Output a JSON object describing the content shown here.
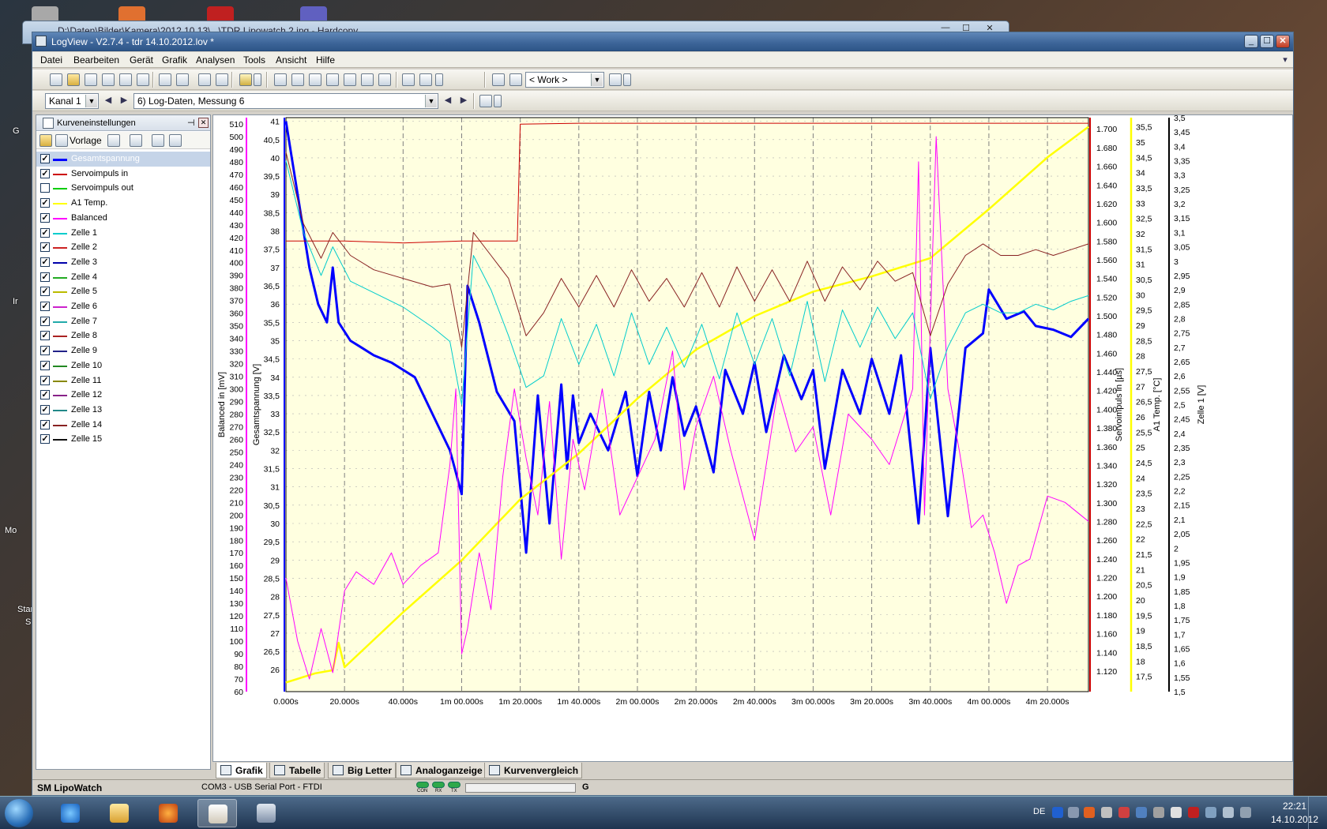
{
  "behind_window": {
    "title": "D:\\Daten\\Bilder\\Kamera\\2012.10.13\\...\\TDR Lipowatch 2.jpg - Hardcopy"
  },
  "desktop": {
    "labels": [
      "G",
      "Ir",
      "Mo",
      "Star",
      "S"
    ]
  },
  "window": {
    "title": "LogView - V2.7.4 - tdr 14.10.2012.lov *"
  },
  "menu": [
    "Datei",
    "Bearbeiten",
    "Gerät",
    "Grafik",
    "Analysen",
    "Tools",
    "Ansicht",
    "Hilfe"
  ],
  "toolbar": {
    "work_combo": "< Work >"
  },
  "toolbar2": {
    "channel": "Kanal 1",
    "measurement": "6) Log-Daten, Messung 6"
  },
  "sidebar": {
    "title": "Kurveneinstellungen",
    "template_label": "Vorlage",
    "curves": [
      {
        "name": "Gesamtspannung",
        "checked": true,
        "color": "#0000ff",
        "selected": true
      },
      {
        "name": "Servoimpuls in",
        "checked": true,
        "color": "#cc0000"
      },
      {
        "name": "Servoimpuls out",
        "checked": false,
        "color": "#00cc00"
      },
      {
        "name": "A1 Temp.",
        "checked": true,
        "color": "#ffff00"
      },
      {
        "name": "Balanced",
        "checked": true,
        "color": "#ff00ff"
      },
      {
        "name": "Zelle 1",
        "checked": true,
        "color": "#00cccc"
      },
      {
        "name": "Zelle 2",
        "checked": true,
        "color": "#cc2222"
      },
      {
        "name": "Zelle 3",
        "checked": true,
        "color": "#0000aa"
      },
      {
        "name": "Zelle 4",
        "checked": true,
        "color": "#22aa22"
      },
      {
        "name": "Zelle 5",
        "checked": true,
        "color": "#bbbb00"
      },
      {
        "name": "Zelle 6",
        "checked": true,
        "color": "#cc22cc"
      },
      {
        "name": "Zelle 7",
        "checked": true,
        "color": "#22aaaa"
      },
      {
        "name": "Zelle 8",
        "checked": true,
        "color": "#aa2222"
      },
      {
        "name": "Zelle 9",
        "checked": true,
        "color": "#222288"
      },
      {
        "name": "Zelle 10",
        "checked": true,
        "color": "#228822"
      },
      {
        "name": "Zelle 11",
        "checked": true,
        "color": "#888800"
      },
      {
        "name": "Zelle 12",
        "checked": true,
        "color": "#882288"
      },
      {
        "name": "Zelle 13",
        "checked": true,
        "color": "#228888"
      },
      {
        "name": "Zelle 14",
        "checked": true,
        "color": "#882222"
      },
      {
        "name": "Zelle 15",
        "checked": true,
        "color": "#111111"
      }
    ]
  },
  "tabs": [
    "Grafik",
    "Tabelle",
    "Big Letter",
    "Analoganzeige",
    "Kurvenvergleich"
  ],
  "status": {
    "device": "SM LipoWatch",
    "port": "COM3 - USB Serial Port - FTDI",
    "leds": [
      "CON",
      "RX",
      "TX"
    ],
    "right": "G"
  },
  "taskbar": {
    "lang": "DE",
    "time": "22:21",
    "date": "14.10.2012"
  },
  "colors": {
    "plot_bg": "#ffffe0",
    "accent": "#3c6498"
  },
  "chart_data": {
    "type": "line",
    "x_ticks": [
      "0.000s",
      "20.000s",
      "40.000s",
      "1m 00.000s",
      "1m 20.000s",
      "1m 40.000s",
      "2m 00.000s",
      "2m 20.000s",
      "2m 40.000s",
      "3m 00.000s",
      "3m 20.000s",
      "3m 40.000s",
      "4m 00.000s",
      "4m 20.000s"
    ],
    "xlim": [
      0,
      274
    ],
    "grid": true,
    "axes": [
      {
        "id": "balanced",
        "title": "Balanced in [mV]",
        "side": "left",
        "ylim": [
          60,
          515
        ],
        "ticks": [
          "510",
          "500",
          "490",
          "480",
          "470",
          "460",
          "450",
          "440",
          "430",
          "420",
          "410",
          "400",
          "390",
          "380",
          "370",
          "360",
          "350",
          "340",
          "330",
          "320",
          "310",
          "300",
          "290",
          "280",
          "270",
          "260",
          "250",
          "240",
          "230",
          "220",
          "210",
          "200",
          "190",
          "180",
          "170",
          "160",
          "150",
          "140",
          "130",
          "120",
          "110",
          "100",
          "90",
          "80",
          "70",
          "60"
        ]
      },
      {
        "id": "gesamt",
        "title": "Gesamtspannung [V]",
        "side": "left",
        "ylim": [
          25.4,
          41.1
        ],
        "ticks": [
          "41",
          "40,5",
          "40",
          "39,5",
          "39",
          "38,5",
          "38",
          "37,5",
          "37",
          "36,5",
          "36",
          "35,5",
          "35",
          "34,5",
          "34",
          "33,5",
          "33",
          "32,5",
          "32",
          "31,5",
          "31",
          "30,5",
          "30",
          "29,5",
          "29",
          "28,5",
          "28",
          "27,5",
          "27",
          "26,5",
          "26"
        ]
      },
      {
        "id": "servo",
        "title": "Servoimpuls in [µs]",
        "side": "right",
        "ylim": [
          1.098,
          1.712
        ],
        "ticks": [
          "1.700",
          "1.680",
          "1.660",
          "1.640",
          "1.620",
          "1.600",
          "1.580",
          "1.560",
          "1.540",
          "1.520",
          "1.500",
          "1.480",
          "1.460",
          "1.440",
          "1.420",
          "1.400",
          "1.380",
          "1.360",
          "1.340",
          "1.320",
          "1.300",
          "1.280",
          "1.260",
          "1.240",
          "1.220",
          "1.200",
          "1.180",
          "1.160",
          "1.140",
          "1.120"
        ]
      },
      {
        "id": "temp",
        "title": "A1 Temp. [°C]",
        "side": "right",
        "ylim": [
          17,
          35.8
        ],
        "ticks": [
          "35,5",
          "35",
          "34,5",
          "34",
          "33,5",
          "33",
          "32,5",
          "32",
          "31,5",
          "31",
          "30,5",
          "30",
          "29,5",
          "29",
          "28,5",
          "28",
          "27,5",
          "27",
          "26,5",
          "26",
          "25,5",
          "25",
          "24,5",
          "24",
          "23,5",
          "23",
          "22,5",
          "22",
          "21,5",
          "21",
          "20,5",
          "20",
          "19,5",
          "19",
          "18,5",
          "18",
          "17,5"
        ]
      },
      {
        "id": "zelle",
        "title": "Zelle 1 [V]",
        "side": "right",
        "ylim": [
          1.5,
          3.5
        ],
        "ticks": [
          "3,5",
          "3,45",
          "3,4",
          "3,35",
          "3,3",
          "3,25",
          "3,2",
          "3,15",
          "3,1",
          "3,05",
          "3",
          "2,95",
          "2,9",
          "2,85",
          "2,8",
          "2,75",
          "2,7",
          "2,65",
          "2,6",
          "2,55",
          "2,5",
          "2,45",
          "2,4",
          "2,35",
          "2,3",
          "2,25",
          "2,2",
          "2,15",
          "2,1",
          "2,05",
          "2",
          "1,95",
          "1,9",
          "1,85",
          "1,8",
          "1,75",
          "1,7",
          "1,65",
          "1,6",
          "1,55",
          "1,5"
        ]
      }
    ],
    "series": [
      {
        "name": "Gesamtspannung",
        "axis": "gesamt",
        "color": "#0000ff",
        "width": 3,
        "x": [
          0,
          4,
          8,
          11,
          14,
          16,
          18,
          22,
          26,
          30,
          36,
          44,
          50,
          56,
          60,
          62,
          66,
          72,
          78,
          82,
          86,
          90,
          94,
          96,
          98,
          100,
          104,
          110,
          116,
          120,
          124,
          128,
          132,
          136,
          140,
          146,
          150,
          156,
          160,
          164,
          170,
          176,
          180,
          184,
          190,
          196,
          200,
          206,
          210,
          216,
          220,
          226,
          232,
          238,
          240,
          246,
          252,
          256,
          262,
          268,
          274
        ],
        "y": [
          41,
          39,
          37,
          36,
          35.5,
          37,
          35.5,
          35,
          34.8,
          34.6,
          34.4,
          34,
          33,
          32,
          30.8,
          36.5,
          35.5,
          33.6,
          32.8,
          29.2,
          33.5,
          30,
          33.8,
          31.5,
          33.5,
          32.2,
          33,
          32,
          33.6,
          31.3,
          33.6,
          32,
          34,
          32.4,
          33.2,
          31.4,
          34.2,
          33,
          34.4,
          32.5,
          34.6,
          33.4,
          34.2,
          31.5,
          34.2,
          33,
          34.5,
          33,
          34.6,
          30,
          34.8,
          30.2,
          34.8,
          35.2,
          36.4,
          35.6,
          35.8,
          35.4,
          35.3,
          35.1,
          35.6
        ]
      },
      {
        "name": "Servoimpuls in",
        "axis": "servo",
        "color": "#cc0000",
        "width": 1,
        "x": [
          0,
          20,
          40,
          60,
          79,
          80,
          100,
          140,
          200,
          240,
          274
        ],
        "y": [
          1.58,
          1.58,
          1.578,
          1.58,
          1.58,
          1.705,
          1.706,
          1.706,
          1.706,
          1.706,
          1.706
        ]
      },
      {
        "name": "A1 Temp.",
        "axis": "temp",
        "color": "#ffff00",
        "width": 2.5,
        "x": [
          0,
          10,
          16,
          18,
          20,
          40,
          60,
          80,
          100,
          120,
          140,
          160,
          180,
          200,
          220,
          240,
          260,
          274
        ],
        "y": [
          17.3,
          17.6,
          17.7,
          18.6,
          17.8,
          19.6,
          21.3,
          23.3,
          24.8,
          26.6,
          28.2,
          29.3,
          30.1,
          30.6,
          31.2,
          32.8,
          34.5,
          35.5
        ]
      },
      {
        "name": "Balanced",
        "axis": "balanced",
        "color": "#ff00ff",
        "width": 1,
        "x": [
          0,
          4,
          8,
          12,
          16,
          20,
          24,
          30,
          36,
          40,
          46,
          52,
          56,
          58,
          60,
          62,
          66,
          70,
          74,
          78,
          82,
          86,
          90,
          94,
          98,
          102,
          108,
          114,
          120,
          126,
          132,
          136,
          140,
          146,
          152,
          160,
          168,
          174,
          180,
          186,
          192,
          200,
          206,
          214,
          216,
          218,
          222,
          226,
          230,
          234,
          238,
          242,
          246,
          250,
          254,
          260,
          266,
          274
        ],
        "y": [
          150,
          100,
          70,
          110,
          75,
          140,
          155,
          145,
          170,
          145,
          160,
          170,
          240,
          300,
          90,
          110,
          170,
          125,
          230,
          300,
          245,
          200,
          290,
          165,
          260,
          220,
          300,
          200,
          230,
          260,
          330,
          220,
          270,
          310,
          250,
          180,
          300,
          250,
          270,
          200,
          280,
          260,
          240,
          300,
          480,
          200,
          500,
          300,
          250,
          190,
          200,
          170,
          130,
          160,
          165,
          215,
          210,
          195
        ]
      },
      {
        "name": "Zelle 1",
        "axis": "zelle",
        "color": "#00cccc",
        "width": 1,
        "x": [
          0,
          6,
          12,
          16,
          22,
          30,
          40,
          50,
          56,
          60,
          64,
          70,
          76,
          82,
          88,
          94,
          100,
          106,
          112,
          118,
          124,
          130,
          136,
          142,
          148,
          154,
          160,
          166,
          172,
          178,
          184,
          190,
          196,
          202,
          208,
          214,
          220,
          226,
          232,
          238,
          244,
          250,
          256,
          262,
          268,
          274
        ],
        "y": [
          3.35,
          3.1,
          2.95,
          3.05,
          2.93,
          2.89,
          2.84,
          2.77,
          2.72,
          2.5,
          3.02,
          2.9,
          2.74,
          2.56,
          2.6,
          2.8,
          2.64,
          2.78,
          2.6,
          2.82,
          2.64,
          2.77,
          2.63,
          2.78,
          2.59,
          2.82,
          2.64,
          2.8,
          2.6,
          2.86,
          2.58,
          2.83,
          2.7,
          2.84,
          2.73,
          2.82,
          2.52,
          2.7,
          2.82,
          2.85,
          2.82,
          2.82,
          2.85,
          2.83,
          2.86,
          2.88
        ]
      },
      {
        "name": "Zelle 14",
        "axis": "zelle",
        "color": "#882222",
        "width": 1,
        "x": [
          0,
          6,
          12,
          16,
          22,
          30,
          40,
          50,
          56,
          60,
          64,
          70,
          76,
          82,
          88,
          94,
          100,
          106,
          112,
          118,
          124,
          130,
          136,
          142,
          148,
          154,
          160,
          166,
          172,
          178,
          184,
          190,
          196,
          202,
          208,
          214,
          220,
          226,
          232,
          238,
          244,
          250,
          256,
          262,
          268,
          274
        ],
        "y": [
          3.38,
          3.13,
          3.01,
          3.1,
          3.02,
          2.97,
          2.94,
          2.91,
          2.92,
          2.7,
          3.1,
          3.02,
          2.94,
          2.74,
          2.82,
          2.94,
          2.84,
          2.95,
          2.84,
          2.97,
          2.86,
          2.94,
          2.84,
          2.96,
          2.84,
          2.98,
          2.86,
          2.97,
          2.86,
          3,
          2.86,
          2.98,
          2.9,
          3,
          2.93,
          2.96,
          2.74,
          2.92,
          3.02,
          3.06,
          3.02,
          3.02,
          3.04,
          3.02,
          3.04,
          3.06
        ]
      }
    ]
  }
}
